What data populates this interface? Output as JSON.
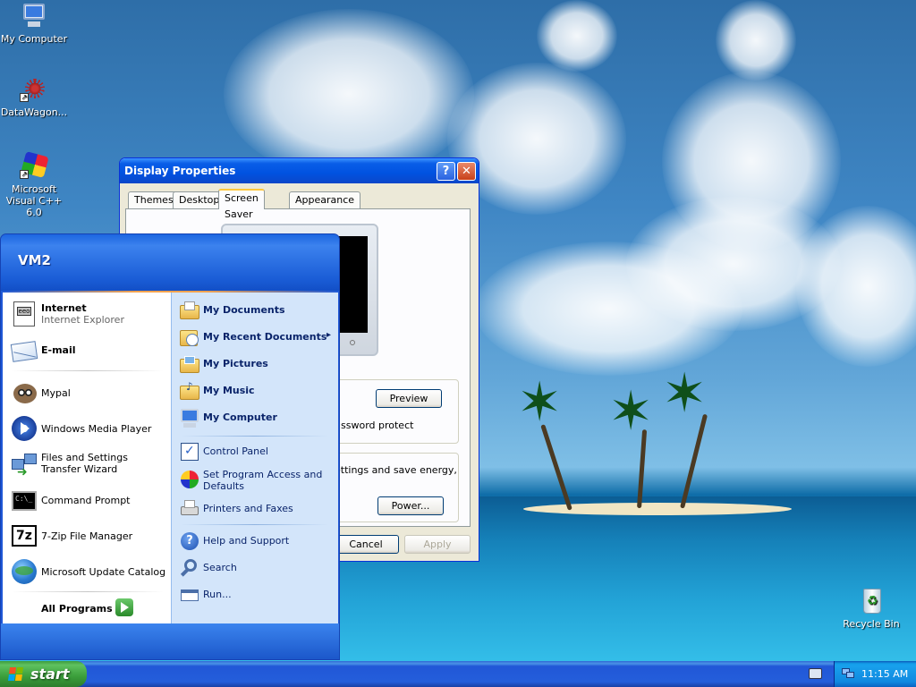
{
  "desktop": {
    "icons": [
      {
        "label": "My Computer",
        "icon": "my-computer-icon"
      },
      {
        "label": "DataWagon...",
        "icon": "datawagon-icon"
      },
      {
        "label": "Microsoft Visual C++ 6.0",
        "icon": "visual-cpp-icon"
      },
      {
        "label": "Recycle Bin",
        "icon": "recycle-bin-icon"
      }
    ]
  },
  "display_properties": {
    "title": "Display Properties",
    "help_glyph": "?",
    "close_glyph": "✕",
    "tabs": [
      "Themes",
      "Desktop",
      "Screen Saver",
      "Appearance"
    ],
    "active_tab": "Screen Saver",
    "settings_button_partial": "ttings",
    "preview_button": "Preview",
    "password_text_partial": "ssword protect",
    "power_text_partial": "ettings and save energy,",
    "power_button": "Power...",
    "cancel_button": "Cancel",
    "apply_button": "Apply"
  },
  "start_menu": {
    "user": "VM2",
    "pinned": [
      {
        "title": "Internet",
        "subtitle": "Internet Explorer",
        "icon": "internet-explorer-icon"
      },
      {
        "title": "E-mail",
        "icon": "email-icon"
      }
    ],
    "recent": [
      {
        "title": "Mypal",
        "icon": "mypal-icon"
      },
      {
        "title": "Windows Media Player",
        "icon": "media-player-icon"
      },
      {
        "title": "Files and Settings Transfer Wizard",
        "icon": "transfer-wizard-icon"
      },
      {
        "title": "Command Prompt",
        "icon": "command-prompt-icon"
      },
      {
        "title": "7-Zip File Manager",
        "icon": "7zip-icon"
      },
      {
        "title": "Microsoft Update Catalog",
        "icon": "update-catalog-icon"
      }
    ],
    "all_programs": "All Programs",
    "places": [
      {
        "title": "My Documents",
        "icon": "folder-documents-icon"
      },
      {
        "title": "My Recent Documents",
        "icon": "recent-documents-icon",
        "arrow": "▸"
      },
      {
        "title": "My Pictures",
        "icon": "folder-pictures-icon"
      },
      {
        "title": "My Music",
        "icon": "folder-music-icon"
      },
      {
        "title": "My Computer",
        "icon": "my-computer-icon"
      }
    ],
    "system": [
      {
        "title": "Control Panel",
        "icon": "control-panel-icon"
      },
      {
        "title": "Set Program Access and Defaults",
        "icon": "program-access-icon"
      },
      {
        "title": "Printers and Faxes",
        "icon": "printer-icon"
      }
    ],
    "support": [
      {
        "title": "Help and Support",
        "icon": "help-icon"
      },
      {
        "title": "Search",
        "icon": "search-icon"
      },
      {
        "title": "Run...",
        "icon": "run-icon"
      }
    ]
  },
  "taskbar": {
    "start_label": "start",
    "clock": "11:15 AM"
  }
}
